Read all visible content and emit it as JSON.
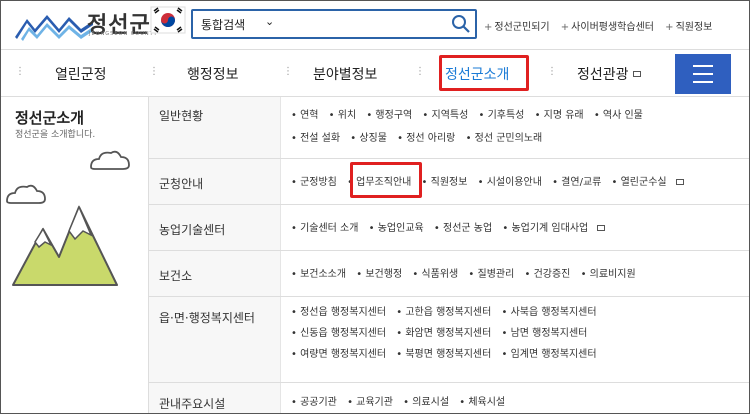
{
  "header": {
    "logo_text": "정선군",
    "logo_sub": "JEONGSEON COUNTY",
    "search": {
      "category": "통합검색",
      "value": ""
    },
    "top_links": [
      "정선군민되기",
      "사이버평생학습센터",
      "직원정보"
    ]
  },
  "nav": {
    "items": [
      "열린군정",
      "행정정보",
      "분야별정보",
      "정선군소개",
      "정선관광"
    ],
    "active": "정선군소개"
  },
  "left": {
    "title": "정선군소개",
    "subtitle": "정선군을 소개합니다."
  },
  "sections": [
    {
      "title": "일반현황",
      "lines": [
        [
          "연혁",
          "위치",
          "행정구역",
          "지역특성",
          "기후특성",
          "지명 유래",
          "역사 인물"
        ],
        [
          "전설 설화",
          "상징물",
          "정선 아리랑",
          "정선 군민의노래"
        ]
      ]
    },
    {
      "title": "군청안내",
      "lines": [
        [
          "군정방침",
          "업무조직안내",
          "직원정보",
          "시설이용안내",
          "결연/교류",
          "열린군수실"
        ]
      ]
    },
    {
      "title": "농업기술센터",
      "lines": [
        [
          "기술센터 소개",
          "농업인교육",
          "정선군 농업",
          "농업기계 임대사업"
        ]
      ]
    },
    {
      "title": "보건소",
      "lines": [
        [
          "보건소소개",
          "보건행정",
          "식품위생",
          "질병관리",
          "건강증진",
          "의료비지원"
        ]
      ]
    },
    {
      "title": "읍·면·행정복지센터",
      "lines": [
        [
          "정선읍 행정복지센터",
          "고한읍 행정복지센터",
          "사북읍 행정복지센터"
        ],
        [
          "신동읍 행정복지센터",
          "화암면 행정복지센터",
          "남면 행정복지센터"
        ],
        [
          "여량면 행정복지센터",
          "북평면 행정복지센터",
          "임계면 행정복지센터"
        ]
      ]
    },
    {
      "title": "관내주요시설",
      "lines": [
        [
          "공공기관",
          "교육기관",
          "의료시설",
          "체육시설"
        ]
      ]
    }
  ],
  "colors": {
    "accent_blue": "#1b7bd6",
    "menu_blue": "#2f5fbf",
    "highlight_red": "#e02020"
  }
}
